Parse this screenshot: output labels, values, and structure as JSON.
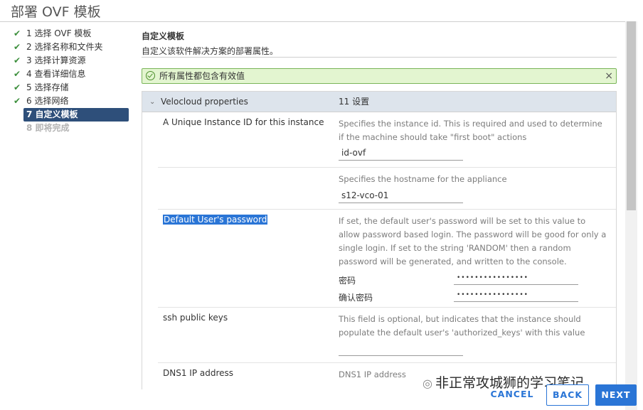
{
  "title": "部署 OVF 模板",
  "nav": [
    {
      "label": "1 选择 OVF 模板",
      "state": "done"
    },
    {
      "label": "2 选择名称和文件夹",
      "state": "done"
    },
    {
      "label": "3 选择计算资源",
      "state": "done"
    },
    {
      "label": "4 查看详细信息",
      "state": "done"
    },
    {
      "label": "5 选择存储",
      "state": "done"
    },
    {
      "label": "6 选择网络",
      "state": "done"
    },
    {
      "label": "7 自定义模板",
      "state": "active"
    },
    {
      "label": "8 即将完成",
      "state": "disabled"
    }
  ],
  "section": {
    "title": "自定义模板",
    "description": "自定义该软件解决方案的部署属性。"
  },
  "banner": {
    "text": "所有属性都包含有效值",
    "close": "×"
  },
  "panel": {
    "name": "Velocloud properties",
    "count": "11 设置",
    "rows": [
      {
        "label": "A Unique Instance ID for this instance",
        "description": "Specifies the instance id.  This is required and used to determine if the machine should take \"first boot\" actions",
        "value": "id-ovf"
      },
      {
        "label": "",
        "description": "Specifies the hostname for the appliance",
        "value": "s12-vco-01"
      },
      {
        "label": "Default User's password",
        "description": "If set, the default user's password will be set to this value to allow password based login.  The password will be good for only a single login.  If set to the string 'RANDOM' then a random password will be generated, and written to the console.",
        "password_label": "密码",
        "password_value": "••••••••••••••••",
        "confirm_label": "确认密码",
        "confirm_value": "••••••••••••••••"
      },
      {
        "label": "ssh public keys",
        "description": "This field is optional, but indicates that the instance should populate the default user's 'authorized_keys' with this value",
        "value": ""
      },
      {
        "label": "DNS1 IP address",
        "description": "DNS1 IP address"
      }
    ]
  },
  "watermark": {
    "icon": "wechat-icon",
    "text": "非正常攻城狮的学习笔记"
  },
  "buttons": {
    "cancel": "CANCEL",
    "back": "BACK",
    "next": "NEXT"
  },
  "colors": {
    "accent": "#2a75d6",
    "nav_active": "#2e4f7a",
    "success_bg": "#e3f5d0",
    "success_border": "#7ab559"
  }
}
